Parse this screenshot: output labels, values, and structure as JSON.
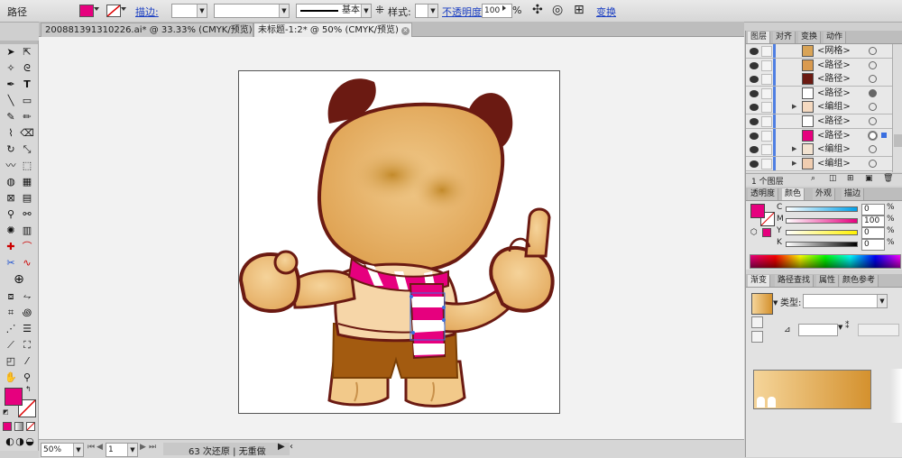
{
  "control_bar": {
    "object_type": "路径",
    "stroke_label": "描边:",
    "stroke_profile": "基本",
    "style_label": "样式:",
    "opacity_label": "不透明度:",
    "opacity_value": "100",
    "opacity_unit": "%",
    "transform_label": "变换",
    "fill_color": "#e6007e"
  },
  "tabs": [
    {
      "label": "200881391310226.ai* @ 33.33% (CMYK/预览)"
    },
    {
      "label": "未标题-1:2* @ 50% (CMYK/预览)"
    }
  ],
  "status_bar": {
    "zoom": "50%",
    "page": "1",
    "history": "63 次还原 | 无重做"
  },
  "layers_panel": {
    "tabs": [
      "图层",
      "对齐",
      "变换",
      "动作"
    ],
    "items": [
      {
        "name": "<网格>",
        "thumb": "#d9a457",
        "expand": false,
        "target": "circle"
      },
      {
        "name": "<路径>",
        "thumb": "#d99a4f",
        "expand": false,
        "target": "circle"
      },
      {
        "name": "<路径>",
        "thumb": "#6b1a12",
        "expand": false,
        "target": "circle"
      },
      {
        "name": "<路径>",
        "thumb": "#ffffff",
        "expand": false,
        "target": "filled"
      },
      {
        "name": "<编组>",
        "thumb": "#f4d9c0",
        "expand": true,
        "target": "circle"
      },
      {
        "name": "<路径>",
        "thumb": "#ffffff",
        "expand": false,
        "target": "circle"
      },
      {
        "name": "<路径>",
        "thumb": "#e6007e",
        "expand": false,
        "target": "selected"
      },
      {
        "name": "<编组>",
        "thumb": "#f2e2d0",
        "expand": true,
        "target": "circle"
      },
      {
        "name": "<编组>",
        "thumb": "#f0cdb0",
        "expand": true,
        "target": "circle"
      }
    ],
    "footer": "1 个图层"
  },
  "color_panel": {
    "tabs": [
      "透明度",
      "颜色",
      "外观",
      "描边"
    ],
    "channels": [
      {
        "label": "C",
        "value": "0",
        "color": "#00a0e9"
      },
      {
        "label": "M",
        "value": "100",
        "color": "#e6007e"
      },
      {
        "label": "Y",
        "value": "0",
        "color": "#fff100"
      },
      {
        "label": "K",
        "value": "0",
        "color": "#000000"
      }
    ]
  },
  "gradient_panel": {
    "tabs": [
      "渐变",
      "路径查找",
      "属性",
      "颜色参考"
    ],
    "type_label": "类型:",
    "start_color": "#f5d59a",
    "end_color": "#d4912e"
  }
}
